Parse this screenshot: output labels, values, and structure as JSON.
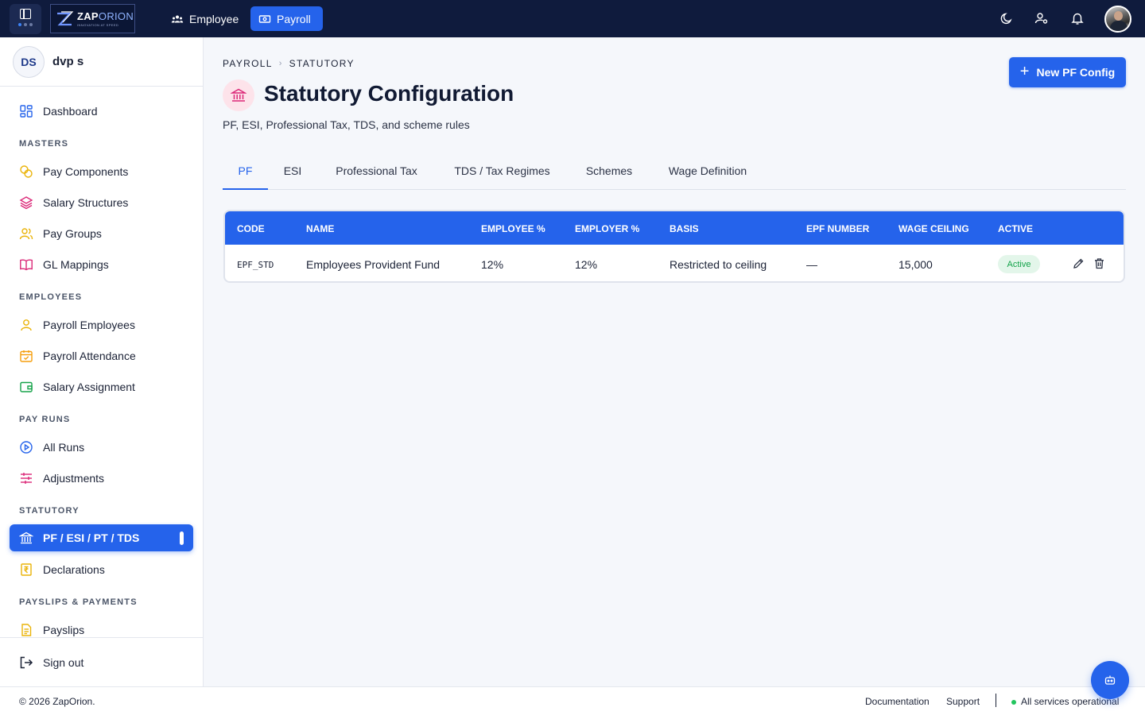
{
  "topbar": {
    "logo_text_a": "ZAP",
    "logo_text_b": "ORION",
    "logo_tagline": "INNOVATION AT SPEED",
    "nav": [
      {
        "label": "Employee",
        "icon": "users-icon",
        "active": false
      },
      {
        "label": "Payroll",
        "icon": "money-icon",
        "active": true
      }
    ],
    "icons": [
      "theme-moon-icon",
      "user-settings-icon",
      "bell-icon"
    ]
  },
  "sidebar": {
    "user_initials": "DS",
    "user_name": "dvp s",
    "items": {
      "dashboard": "Dashboard",
      "pay_components": "Pay Components",
      "salary_structures": "Salary Structures",
      "pay_groups": "Pay Groups",
      "gl_mappings": "GL Mappings",
      "payroll_employees": "Payroll Employees",
      "payroll_attendance": "Payroll Attendance",
      "salary_assignment": "Salary Assignment",
      "all_runs": "All Runs",
      "adjustments": "Adjustments",
      "pf_esi_pt_tds": "PF / ESI / PT / TDS",
      "declarations": "Declarations",
      "payslips": "Payslips",
      "sign_out": "Sign out"
    },
    "sections": {
      "masters": "MASTERS",
      "employees": "EMPLOYEES",
      "pay_runs": "PAY RUNS",
      "statutory": "STATUTORY",
      "payslips_payments": "PAYSLIPS & PAYMENTS"
    },
    "active_item": "PF / ESI / PT / TDS"
  },
  "breadcrumb": {
    "root": "PAYROLL",
    "separator": "›",
    "current": "STATUTORY"
  },
  "header": {
    "title": "Statutory Configuration",
    "subtitle": "PF, ESI, Professional Tax, TDS, and scheme rules",
    "new_button_label": "New PF Config"
  },
  "tabs": {
    "pf": "PF",
    "esi": "ESI",
    "professional_tax": "Professional Tax",
    "tds": "TDS / Tax Regimes",
    "schemes": "Schemes",
    "wage_definition": "Wage Definition",
    "active": "PF"
  },
  "table": {
    "columns": {
      "code": "CODE",
      "name": "NAME",
      "employee_pct": "EMPLOYEE %",
      "employer_pct": "EMPLOYER %",
      "basis": "BASIS",
      "epf_number": "EPF NUMBER",
      "wage_ceiling": "WAGE CEILING",
      "active": "ACTIVE"
    },
    "rows": [
      {
        "code": "EPF_STD",
        "name": "Employees Provident Fund",
        "employee_pct": "12%",
        "employer_pct": "12%",
        "basis": "Restricted to ceiling",
        "epf_number": "—",
        "wage_ceiling": "15,000",
        "active": "Active"
      }
    ]
  },
  "footer": {
    "copyright": "© 2026 ZapOrion.",
    "documentation": "Documentation",
    "support": "Support",
    "status": "All services operational"
  },
  "colors": {
    "accent": "#2563eb",
    "topbar": "#0f1b3d",
    "status_ok": "#22c55e"
  }
}
